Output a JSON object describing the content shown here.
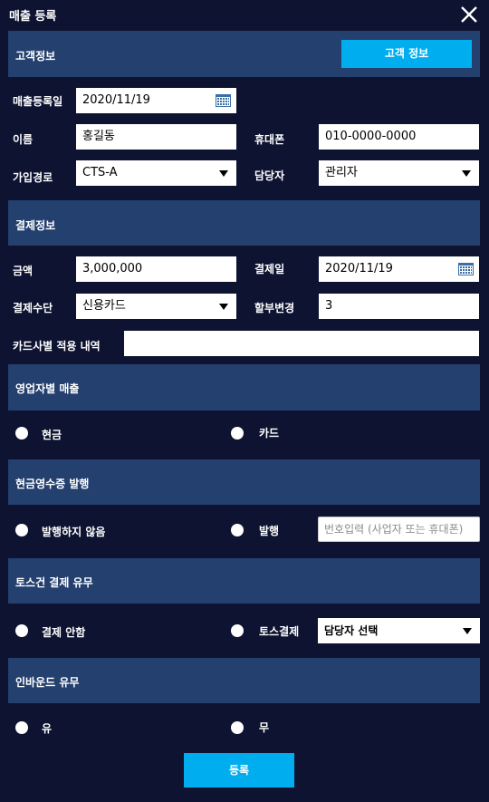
{
  "window": {
    "title": "매출 등록"
  },
  "customer_section": {
    "header": "고객정보",
    "customer_button": "고객 정보",
    "sale_date_label": "매출등록일",
    "sale_date_value": "2020/11/19",
    "name_label": "이름",
    "name_value": "홍길동",
    "phone_label": "휴대폰",
    "phone_value": "010-0000-0000",
    "join_route_label": "가입경로",
    "join_route_value": "CTS-A",
    "manager_label": "담당자",
    "manager_value": "관리자"
  },
  "payment_section": {
    "header": "결제정보",
    "amount_label": "금액",
    "amount_value": "3,000,000",
    "payment_date_label": "결제일",
    "payment_date_value": "2020/11/19",
    "method_label": "결제수단",
    "method_value": "신용카드",
    "installment_label": "할부변경",
    "installment_value": "3",
    "card_detail_label": "카드사별 적용 내역",
    "card_detail_value": ""
  },
  "sales_type_section": {
    "header": "영업자별 매출",
    "option_cash": "현금",
    "option_card": "카드"
  },
  "receipt_section": {
    "header": "현금영수증 발행",
    "option_not_issue": "발행하지 않음",
    "option_issue": "발행",
    "number_placeholder": "번호입력 (사업자 또는 휴대폰)"
  },
  "toss_section": {
    "header": "토스건 결제 유무",
    "option_no": "결제 안함",
    "option_toss": "토스결제",
    "manager_select": "담당자 선택"
  },
  "inbound_section": {
    "header": "인바운드 유무",
    "option_yes": "유",
    "option_no": "무"
  },
  "footer": {
    "submit_label": "등록"
  },
  "colors": {
    "background": "#0d1330",
    "section_header": "#24406f",
    "accent_button": "#00aef0",
    "field": "#ffffff"
  },
  "icons": {
    "close": "close-icon",
    "calendar": "calendar-icon",
    "dropdown": "caret-down-icon"
  }
}
